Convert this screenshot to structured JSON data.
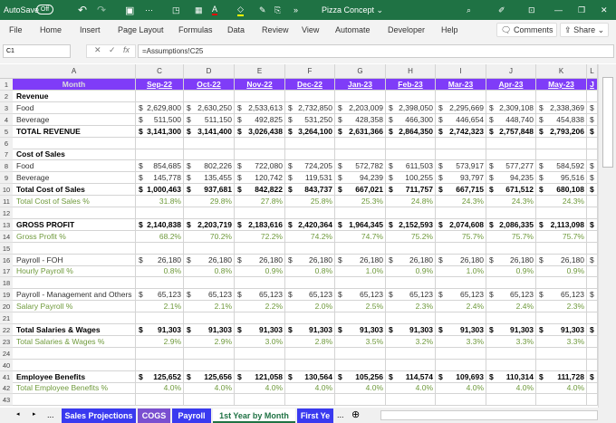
{
  "title": {
    "autosave": "AutoSave",
    "toggle": "Off",
    "doc": "Pizza Concept ⌄",
    "more": "»"
  },
  "menu": [
    "File",
    "Home",
    "Insert",
    "Page Layout",
    "Formulas",
    "Data",
    "Review",
    "View",
    "Automate",
    "Developer",
    "Help"
  ],
  "comments": "Comments",
  "share": "Share",
  "namebox": "C1",
  "formula": "=Assumptions!C25",
  "fx": "fx",
  "colors": {
    "header": "#7f3cf8",
    "titlebar": "#1f7244",
    "pct": "#6f9a3c"
  },
  "columns": [
    "A",
    "C",
    "D",
    "E",
    "F",
    "G",
    "H",
    "I",
    "J",
    "K",
    "L"
  ],
  "rows": [
    {
      "n": "1",
      "t": "hdr",
      "label": "Month",
      "cells": [
        "Sep-22",
        "Oct-22",
        "Nov-22",
        "Dec-22",
        "Jan-23",
        "Feb-23",
        "Mar-23",
        "Apr-23",
        "May-23",
        "J"
      ]
    },
    {
      "n": "2",
      "t": "bold",
      "label": "Revenue",
      "cells": []
    },
    {
      "n": "3",
      "t": "normal",
      "cur": true,
      "label": "Food",
      "cells": [
        "2,629,800",
        "2,630,250",
        "2,533,613",
        "2,732,850",
        "2,203,009",
        "2,398,050",
        "2,295,669",
        "2,309,108",
        "2,338,369",
        ""
      ]
    },
    {
      "n": "4",
      "t": "normal",
      "cur": true,
      "label": "Beverage",
      "cells": [
        "511,500",
        "511,150",
        "492,825",
        "531,250",
        "428,358",
        "466,300",
        "446,654",
        "448,740",
        "454,838",
        ""
      ]
    },
    {
      "n": "5",
      "t": "bold",
      "cur": true,
      "label": "TOTAL REVENUE",
      "cells": [
        "3,141,300",
        "3,141,400",
        "3,026,438",
        "3,264,100",
        "2,631,366",
        "2,864,350",
        "2,742,323",
        "2,757,848",
        "2,793,206",
        ""
      ]
    },
    {
      "n": "6",
      "t": "normal",
      "label": "",
      "cells": []
    },
    {
      "n": "7",
      "t": "bold",
      "label": "Cost of Sales",
      "cells": []
    },
    {
      "n": "8",
      "t": "normal",
      "cur": true,
      "label": "Food",
      "cells": [
        "854,685",
        "802,226",
        "722,080",
        "724,205",
        "572,782",
        "611,503",
        "573,917",
        "577,277",
        "584,592",
        ""
      ]
    },
    {
      "n": "9",
      "t": "normal",
      "cur": true,
      "label": "Beverage",
      "cells": [
        "145,778",
        "135,455",
        "120,742",
        "119,531",
        "94,239",
        "100,255",
        "93,797",
        "94,235",
        "95,516",
        ""
      ]
    },
    {
      "n": "10",
      "t": "bold",
      "cur": true,
      "label": "Total Cost of Sales",
      "cells": [
        "1,000,463",
        "937,681",
        "842,822",
        "843,737",
        "667,021",
        "711,757",
        "667,715",
        "671,512",
        "680,108",
        ""
      ]
    },
    {
      "n": "11",
      "t": "green",
      "label": "Total Cost of Sales %",
      "cells": [
        "31.8%",
        "29.8%",
        "27.8%",
        "25.8%",
        "25.3%",
        "24.8%",
        "24.3%",
        "24.3%",
        "24.3%",
        ""
      ]
    },
    {
      "n": "12",
      "t": "normal",
      "label": "",
      "cells": []
    },
    {
      "n": "13",
      "t": "bold",
      "cur": true,
      "label": "GROSS PROFIT",
      "cells": [
        "2,140,838",
        "2,203,719",
        "2,183,616",
        "2,420,364",
        "1,964,345",
        "2,152,593",
        "2,074,608",
        "2,086,335",
        "2,113,098",
        ""
      ]
    },
    {
      "n": "14",
      "t": "green",
      "label": "Gross Profit %",
      "cells": [
        "68.2%",
        "70.2%",
        "72.2%",
        "74.2%",
        "74.7%",
        "75.2%",
        "75.7%",
        "75.7%",
        "75.7%",
        ""
      ]
    },
    {
      "n": "15",
      "t": "normal",
      "label": "",
      "cells": []
    },
    {
      "n": "16",
      "t": "normal",
      "cur": true,
      "label": "Payroll - FOH",
      "cells": [
        "26,180",
        "26,180",
        "26,180",
        "26,180",
        "26,180",
        "26,180",
        "26,180",
        "26,180",
        "26,180",
        ""
      ]
    },
    {
      "n": "17",
      "t": "green",
      "label": "Hourly Payroll %",
      "cells": [
        "0.8%",
        "0.8%",
        "0.9%",
        "0.8%",
        "1.0%",
        "0.9%",
        "1.0%",
        "0.9%",
        "0.9%",
        ""
      ]
    },
    {
      "n": "18",
      "t": "normal",
      "label": "",
      "cells": []
    },
    {
      "n": "19",
      "t": "normal",
      "cur": true,
      "label": "Payroll - Management and Others",
      "cells": [
        "65,123",
        "65,123",
        "65,123",
        "65,123",
        "65,123",
        "65,123",
        "65,123",
        "65,123",
        "65,123",
        ""
      ]
    },
    {
      "n": "20",
      "t": "green",
      "label": "Salary Payroll %",
      "cells": [
        "2.1%",
        "2.1%",
        "2.2%",
        "2.0%",
        "2.5%",
        "2.3%",
        "2.4%",
        "2.4%",
        "2.3%",
        ""
      ]
    },
    {
      "n": "21",
      "t": "normal",
      "label": "",
      "cells": []
    },
    {
      "n": "22",
      "t": "bold",
      "cur": true,
      "label": "Total Salaries & Wages",
      "cells": [
        "91,303",
        "91,303",
        "91,303",
        "91,303",
        "91,303",
        "91,303",
        "91,303",
        "91,303",
        "91,303",
        ""
      ]
    },
    {
      "n": "23",
      "t": "green",
      "label": "Total Salaries & Wages %",
      "cells": [
        "2.9%",
        "2.9%",
        "3.0%",
        "2.8%",
        "3.5%",
        "3.2%",
        "3.3%",
        "3.3%",
        "3.3%",
        ""
      ]
    },
    {
      "n": "24",
      "t": "normal",
      "label": "",
      "cells": []
    },
    {
      "n": "40",
      "t": "normal",
      "label": "",
      "cells": []
    },
    {
      "n": "41",
      "t": "bold",
      "cur": true,
      "label": "Employee Benefits",
      "cells": [
        "125,652",
        "125,656",
        "121,058",
        "130,564",
        "105,256",
        "114,574",
        "109,693",
        "110,314",
        "111,728",
        ""
      ]
    },
    {
      "n": "42",
      "t": "green",
      "label": "Total Employee Benefits %",
      "cells": [
        "4.0%",
        "4.0%",
        "4.0%",
        "4.0%",
        "4.0%",
        "4.0%",
        "4.0%",
        "4.0%",
        "4.0%",
        ""
      ]
    },
    {
      "n": "43",
      "t": "normal",
      "label": "",
      "cells": []
    }
  ],
  "sheets": [
    {
      "label": "Sales Projections",
      "bg": "#3a3af0",
      "color": "#fff"
    },
    {
      "label": "COGS",
      "bg": "#7a4fd0",
      "color": "#fff"
    },
    {
      "label": "Payroll",
      "bg": "#3a3af0",
      "color": "#fff"
    },
    {
      "label": "1st Year by Month",
      "bg": "#ffffff",
      "color": "#1f7244"
    },
    {
      "label": "First Ye",
      "bg": "#3a3af0",
      "color": "#fff"
    }
  ],
  "tabnav": {
    "prev": "◂",
    "next": "▸",
    "more": "...",
    "more2": "...",
    "add": "⊕"
  }
}
